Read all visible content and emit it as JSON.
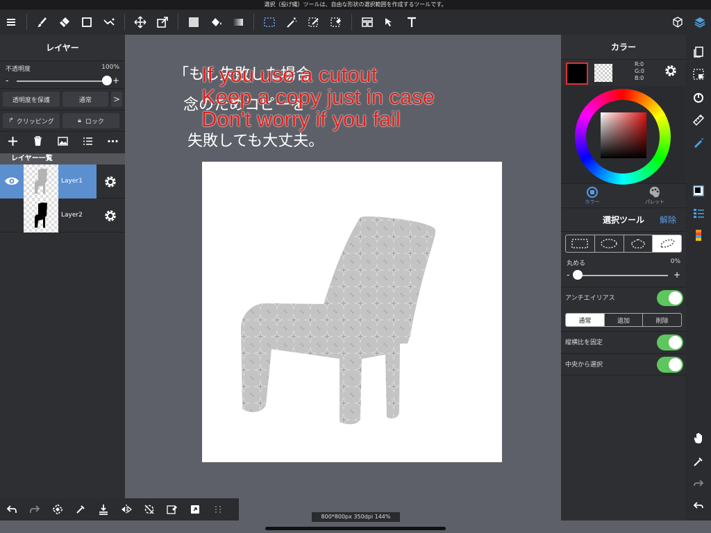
{
  "hint_text": "選択（投げ縄）ツールは、自由な形状の選択範囲を作成するツールです。",
  "toolbar": {
    "left_icons": [
      "menu-icon",
      "brush-icon",
      "eraser-icon",
      "rectangle-icon",
      "filter-icon",
      "move-icon",
      "transform-icon",
      "fill-color-icon",
      "bucket-icon",
      "gradient-icon",
      "selection-icon",
      "magic-wand-icon",
      "select-pen-icon",
      "select-eraser-icon",
      "layout-icon",
      "select-layer-icon",
      "text-icon"
    ],
    "right_icons": [
      "3d-icon",
      "layers-icon"
    ]
  },
  "left_panel": {
    "title": "レイヤー",
    "opacity_label": "不透明度",
    "opacity_value": "100%",
    "opacity_level": 1.0,
    "minus": "-",
    "plus": "+",
    "protect_alpha_label": "透明度を保護",
    "blend_label": "通常",
    "blend_arrow": ">",
    "clipping_label": "クリッピング",
    "lock_label": "ロック",
    "list_header": "レイヤー一覧",
    "layers": [
      {
        "name": "Layer1",
        "selected": true,
        "visible": true
      },
      {
        "name": "Layer2",
        "selected": false,
        "visible": false
      }
    ]
  },
  "canvas": {
    "handwritten_note": [
      "「もし失敗した場合",
      "念のためコピーを",
      "失敗しても大丈夫。"
    ],
    "overlay_lines": [
      "If you use a cutout",
      "Keep a copy just in case",
      "Don't worry if you fail"
    ],
    "overlay_color": "#e0201a",
    "status": "800*800px 350dpi 144%"
  },
  "right_panel": {
    "color_title": "カラー",
    "rgb": {
      "r": "R:0",
      "g": "G:0",
      "b": "B:0"
    },
    "tab_color": "カラー",
    "tab_palette": "パレット",
    "select_tool_title": "選択ツール",
    "clear_label": "解除",
    "round_label": "丸める",
    "round_value": "0%",
    "round_level": 0,
    "minus": "-",
    "plus": "+",
    "antialias_label": "アンチエイリアス",
    "mode_normal": "通常",
    "mode_add": "追加",
    "mode_delete": "削除",
    "fix_ratio_label": "縦横比を固定",
    "from_center_label": "中央から選択",
    "accent": "#5b9be6",
    "toggle_color": "#5ec65e"
  }
}
